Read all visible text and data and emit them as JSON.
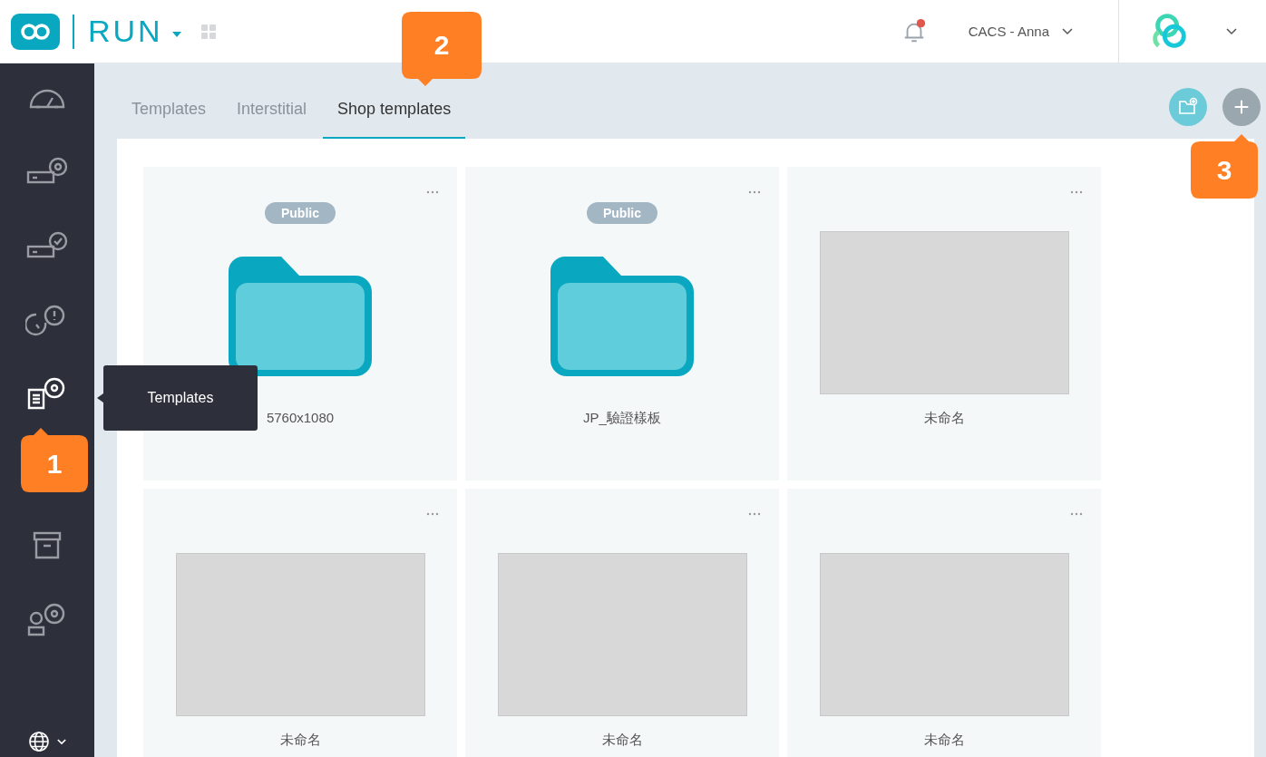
{
  "header": {
    "app_name": "RUN",
    "notifications": {
      "unread": true
    },
    "user": "CACS - Anna"
  },
  "sidebar": {
    "items": [
      {
        "selected": false
      },
      {
        "selected": false
      },
      {
        "selected": false
      },
      {
        "selected": false
      },
      {
        "selected": true
      },
      {
        "selected": false
      },
      {
        "selected": false
      }
    ]
  },
  "tooltip": {
    "text": "Templates"
  },
  "tabs": [
    {
      "label": "Templates",
      "selected": false
    },
    {
      "label": "Interstitial",
      "selected": false
    },
    {
      "label": "Shop templates",
      "selected": true
    }
  ],
  "cards": [
    {
      "kind": "folder",
      "badge": "Public",
      "name": "5760x1080"
    },
    {
      "kind": "folder",
      "badge": "Public",
      "name": "JP_驗證樣板"
    },
    {
      "kind": "template",
      "name": "未命名"
    },
    {
      "kind": "template",
      "name": "未命名"
    },
    {
      "kind": "template",
      "name": "未命名"
    },
    {
      "kind": "template",
      "name": "未命名"
    }
  ],
  "callouts": [
    {
      "number": "1"
    },
    {
      "number": "2"
    },
    {
      "number": "3"
    }
  ]
}
